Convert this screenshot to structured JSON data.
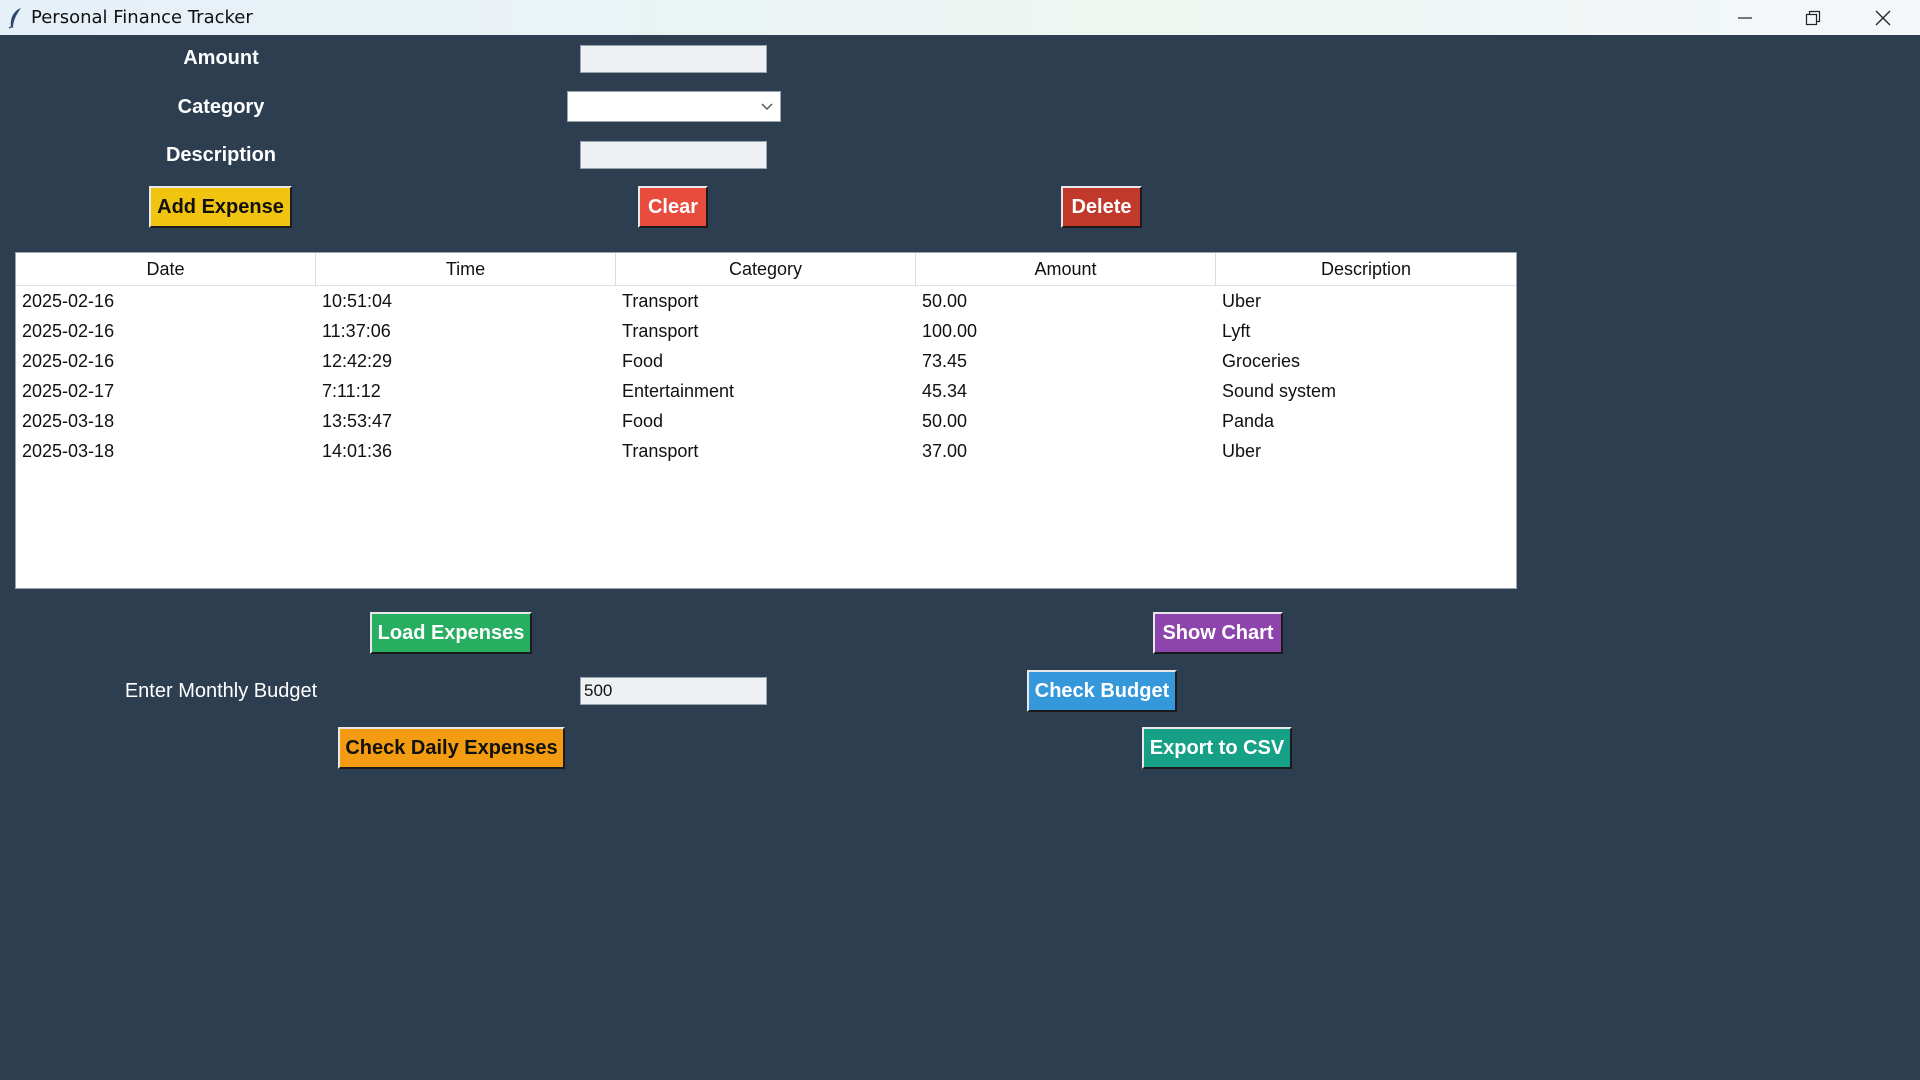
{
  "window": {
    "title": "Personal Finance Tracker"
  },
  "form": {
    "amount_label": "Amount",
    "category_label": "Category",
    "description_label": "Description",
    "amount_value": "",
    "category_value": "",
    "description_value": ""
  },
  "buttons": {
    "add_expense": "Add Expense",
    "clear": "Clear",
    "delete": "Delete",
    "load_expenses": "Load Expenses",
    "show_chart": "Show Chart",
    "check_budget": "Check Budget",
    "check_daily": "Check Daily Expenses",
    "export_csv": "Export to CSV"
  },
  "table": {
    "columns": [
      "Date",
      "Time",
      "Category",
      "Amount",
      "Description"
    ],
    "rows": [
      [
        "2025-02-16",
        "10:51:04",
        "Transport",
        "50.00",
        "Uber"
      ],
      [
        "2025-02-16",
        "11:37:06",
        "Transport",
        "100.00",
        "Lyft"
      ],
      [
        "2025-02-16",
        "12:42:29",
        "Food",
        "73.45",
        "Groceries"
      ],
      [
        "2025-02-17",
        "7:11:12",
        "Entertainment",
        "45.34",
        "Sound system"
      ],
      [
        "2025-03-18",
        "13:53:47",
        "Food",
        "50.00",
        "Panda"
      ],
      [
        "2025-03-18",
        "14:01:36",
        "Transport",
        "37.00",
        "Uber"
      ]
    ]
  },
  "budget": {
    "label": "Enter Monthly Budget",
    "value": "500"
  },
  "colors": {
    "background": "#2c3e50",
    "add_expense": "#f1c40f",
    "clear": "#e74c3c",
    "delete": "#c0392b",
    "load_expenses": "#27ae60",
    "show_chart": "#8e44ad",
    "check_budget": "#3498db",
    "check_daily": "#f39c12",
    "export_csv": "#16a085"
  },
  "icons": {
    "app": "feather-icon",
    "minimize": "minimize-icon",
    "restore": "restore-icon",
    "close": "close-icon",
    "dropdown": "chevron-down-icon"
  }
}
